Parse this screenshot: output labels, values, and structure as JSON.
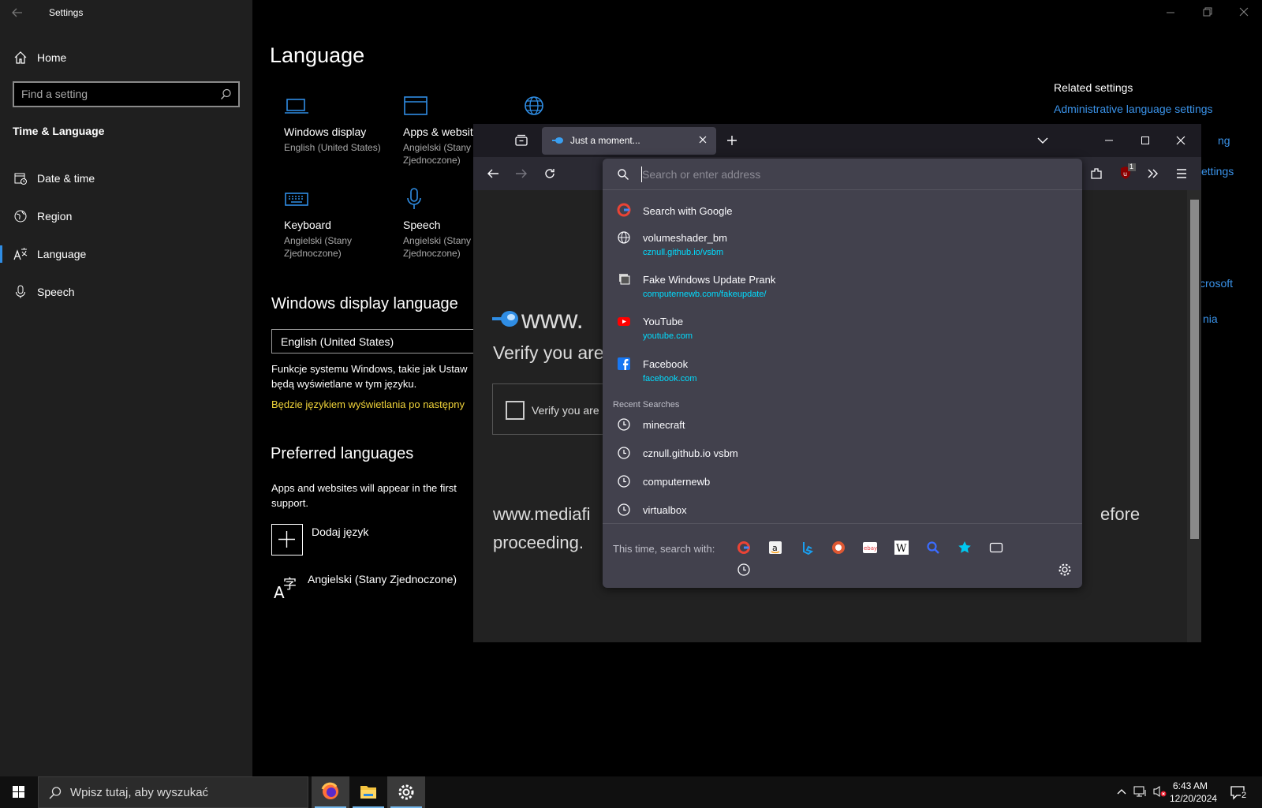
{
  "settings": {
    "window_title": "Settings",
    "home": "Home",
    "search_placeholder": "Find a setting",
    "section": "Time & Language",
    "nav": [
      {
        "label": "Date & time",
        "icon": "calendar-clock-icon"
      },
      {
        "label": "Region",
        "icon": "globe-region-icon"
      },
      {
        "label": "Language",
        "icon": "language-icon",
        "selected": true
      },
      {
        "label": "Speech",
        "icon": "microphone-icon"
      }
    ],
    "page_title": "Language",
    "tiles": [
      {
        "title": "Windows display",
        "sub": "English (United States)",
        "icon": "monitor-icon"
      },
      {
        "title": "Apps & websit",
        "sub": "Angielski (Stany Zjednoczone)",
        "icon": "browser-window-icon"
      },
      {
        "title": "Keyboard",
        "sub": "Angielski (Stany Zjednoczone)",
        "icon": "keyboard-icon"
      },
      {
        "title": "Speech",
        "sub": "Angielski (Stany Zjednoczone)",
        "icon": "microphone-icon"
      }
    ],
    "display_lang_heading": "Windows display language",
    "display_lang_value": "English (United States)",
    "display_lang_desc1": "Funkcje systemu Windows, takie jak Ustaw",
    "display_lang_desc2": "będą wyświetlane w tym języku.",
    "display_lang_note": "Będzie językiem wyświetlania po następny",
    "pref_heading": "Preferred languages",
    "pref_desc1": "Apps and websites will appear in the first",
    "pref_desc2": "support.",
    "add_lang": "Dodaj język",
    "lang_item": "Angielski (Stany Zjednoczone)",
    "related_heading": "Related settings",
    "related_links": [
      "Administrative language settings",
      "ng",
      "ettings",
      "crosoft",
      "nia"
    ],
    "accent": "#2f8de4"
  },
  "browser": {
    "tab_title": "Just a moment...",
    "page": {
      "site_fragment": "www.",
      "verify_fragment": "Verify you are",
      "checkbox_fragment": "Verify you are h",
      "long_text_left": "www.mediafi",
      "long_text_right": "efore",
      "long_text_line2": "proceeding."
    },
    "address_placeholder": "Search or enter address",
    "extension_badge": "1",
    "suggestions": [
      {
        "title": "Search with Google",
        "icon": "google-icon"
      },
      {
        "title": "volumeshader_bm",
        "url": "cznull.github.io/vsbm",
        "icon": "globe-icon"
      },
      {
        "title": "Fake Windows Update Prank",
        "url": "computernewb.com/fakeupdate/",
        "icon": "site-favicon-icon"
      },
      {
        "title": "YouTube",
        "url": "youtube.com",
        "icon": "youtube-icon"
      },
      {
        "title": "Facebook",
        "url": "facebook.com",
        "icon": "facebook-icon"
      }
    ],
    "recent_heading": "Recent Searches",
    "recent": [
      "minecraft",
      "cznull.github.io vsbm",
      "computernewb",
      "virtualbox"
    ],
    "search_with_label": "This time, search with:",
    "engines": [
      "google-icon",
      "amazon-icon",
      "bing-icon",
      "duckduckgo-icon",
      "ebay-icon",
      "wikipedia-icon",
      "search-engine-icon",
      "bookmarks-star-icon",
      "tabs-icon",
      "history-icon"
    ]
  },
  "taskbar": {
    "search_placeholder": "Wpisz tutaj, aby wyszukać",
    "time": "6:43 AM",
    "date": "12/20/2024",
    "notification_count": "2"
  }
}
